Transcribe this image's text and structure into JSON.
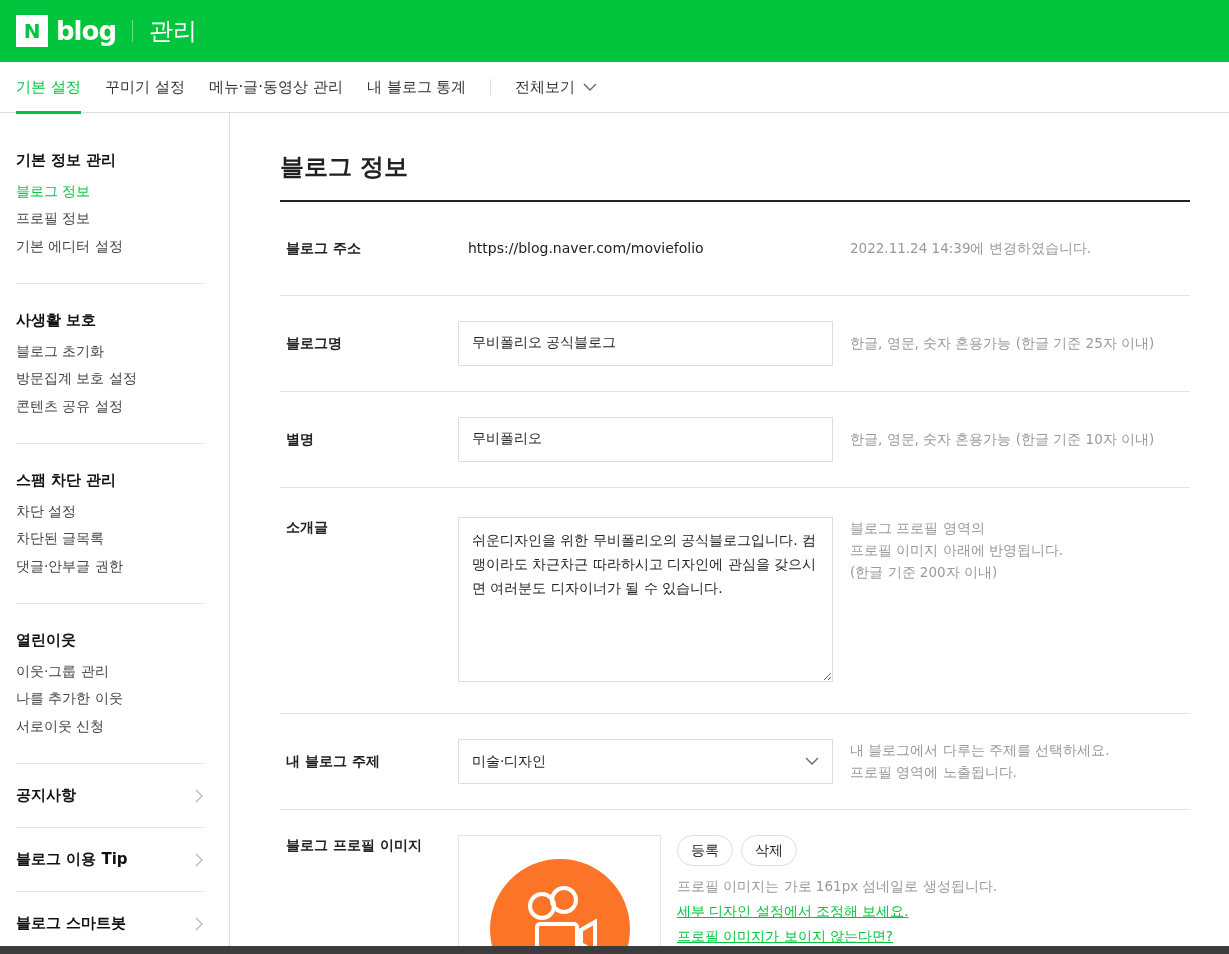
{
  "header": {
    "logo_mark": "N",
    "logo_text": "blog",
    "title": "관리"
  },
  "tabs": [
    {
      "label": "기본 설정",
      "selected": true
    },
    {
      "label": "꾸미기 설정",
      "selected": false
    },
    {
      "label": "메뉴·글·동영상 관리",
      "selected": false
    },
    {
      "label": "내 블로그 통계",
      "selected": false
    }
  ],
  "view_all": "전체보기",
  "sidebar": {
    "sections": [
      {
        "title": "기본 정보 관리",
        "items": [
          {
            "label": "블로그 정보",
            "selected": true
          },
          {
            "label": "프로필 정보",
            "selected": false
          },
          {
            "label": "기본 에디터 설정",
            "selected": false
          }
        ]
      },
      {
        "title": "사생활 보호",
        "items": [
          {
            "label": "블로그 초기화",
            "selected": false
          },
          {
            "label": "방문집계 보호 설정",
            "selected": false
          },
          {
            "label": "콘텐츠 공유 설정",
            "selected": false
          }
        ]
      },
      {
        "title": "스팸 차단 관리",
        "items": [
          {
            "label": "차단 설정",
            "selected": false
          },
          {
            "label": "차단된 글목록",
            "selected": false
          },
          {
            "label": "댓글·안부글 권한",
            "selected": false
          }
        ]
      },
      {
        "title": "열린이웃",
        "items": [
          {
            "label": "이웃·그룹 관리",
            "selected": false
          },
          {
            "label": "나를 추가한 이웃",
            "selected": false
          },
          {
            "label": "서로이웃 신청",
            "selected": false
          }
        ]
      }
    ],
    "links": [
      "공지사항",
      "블로그 이용 Tip",
      "블로그 스마트봇"
    ]
  },
  "page_title": "블로그 정보",
  "rows": [
    {
      "kind": "text",
      "label": "블로그 주소",
      "value": "https://blog.naver.com/moviefolio",
      "help": [
        "2022.11.24 14:39에 변경하였습니다."
      ]
    },
    {
      "kind": "input",
      "label": "블로그명",
      "value": "무비폴리오 공식블로그",
      "help": [
        "한글, 영문, 숫자 혼용가능 (한글 기준 25자 이내)"
      ]
    },
    {
      "kind": "input",
      "label": "별명",
      "value": "무비폴리오",
      "help": [
        "한글, 영문, 숫자 혼용가능 (한글 기준 10자 이내)"
      ]
    },
    {
      "kind": "textarea",
      "label": "소개글",
      "value": "쉬운디자인을 위한 무비폴리오의 공식블로그입니다. 컴맹이라도 차근차근 따라하시고 디자인에 관심을 갖으시면 여러분도 디자이너가 될 수 있습니다.",
      "help": [
        "블로그 프로필 영역의",
        "프로필 이미지 아래에 반영됩니다.",
        "(한글 기준 200자 이내)"
      ]
    },
    {
      "kind": "select",
      "label": "내 블로그 주제",
      "value": "미술·디자인",
      "help": [
        "내 블로그에서 다루는 주제를 선택하세요.",
        "프로필 영역에 노출됩니다."
      ]
    },
    {
      "label": "블로그 프로필 이미지",
      "buttons": [
        "등록",
        "삭제"
      ],
      "help": [
        "프로필 이미지는 가로 161px 섬네일로 생성됩니다."
      ],
      "links": [
        "세부 디자인 설정에서 조정해 보세요.",
        "프로필 이미지가 보이지 않는다면?"
      ]
    }
  ]
}
